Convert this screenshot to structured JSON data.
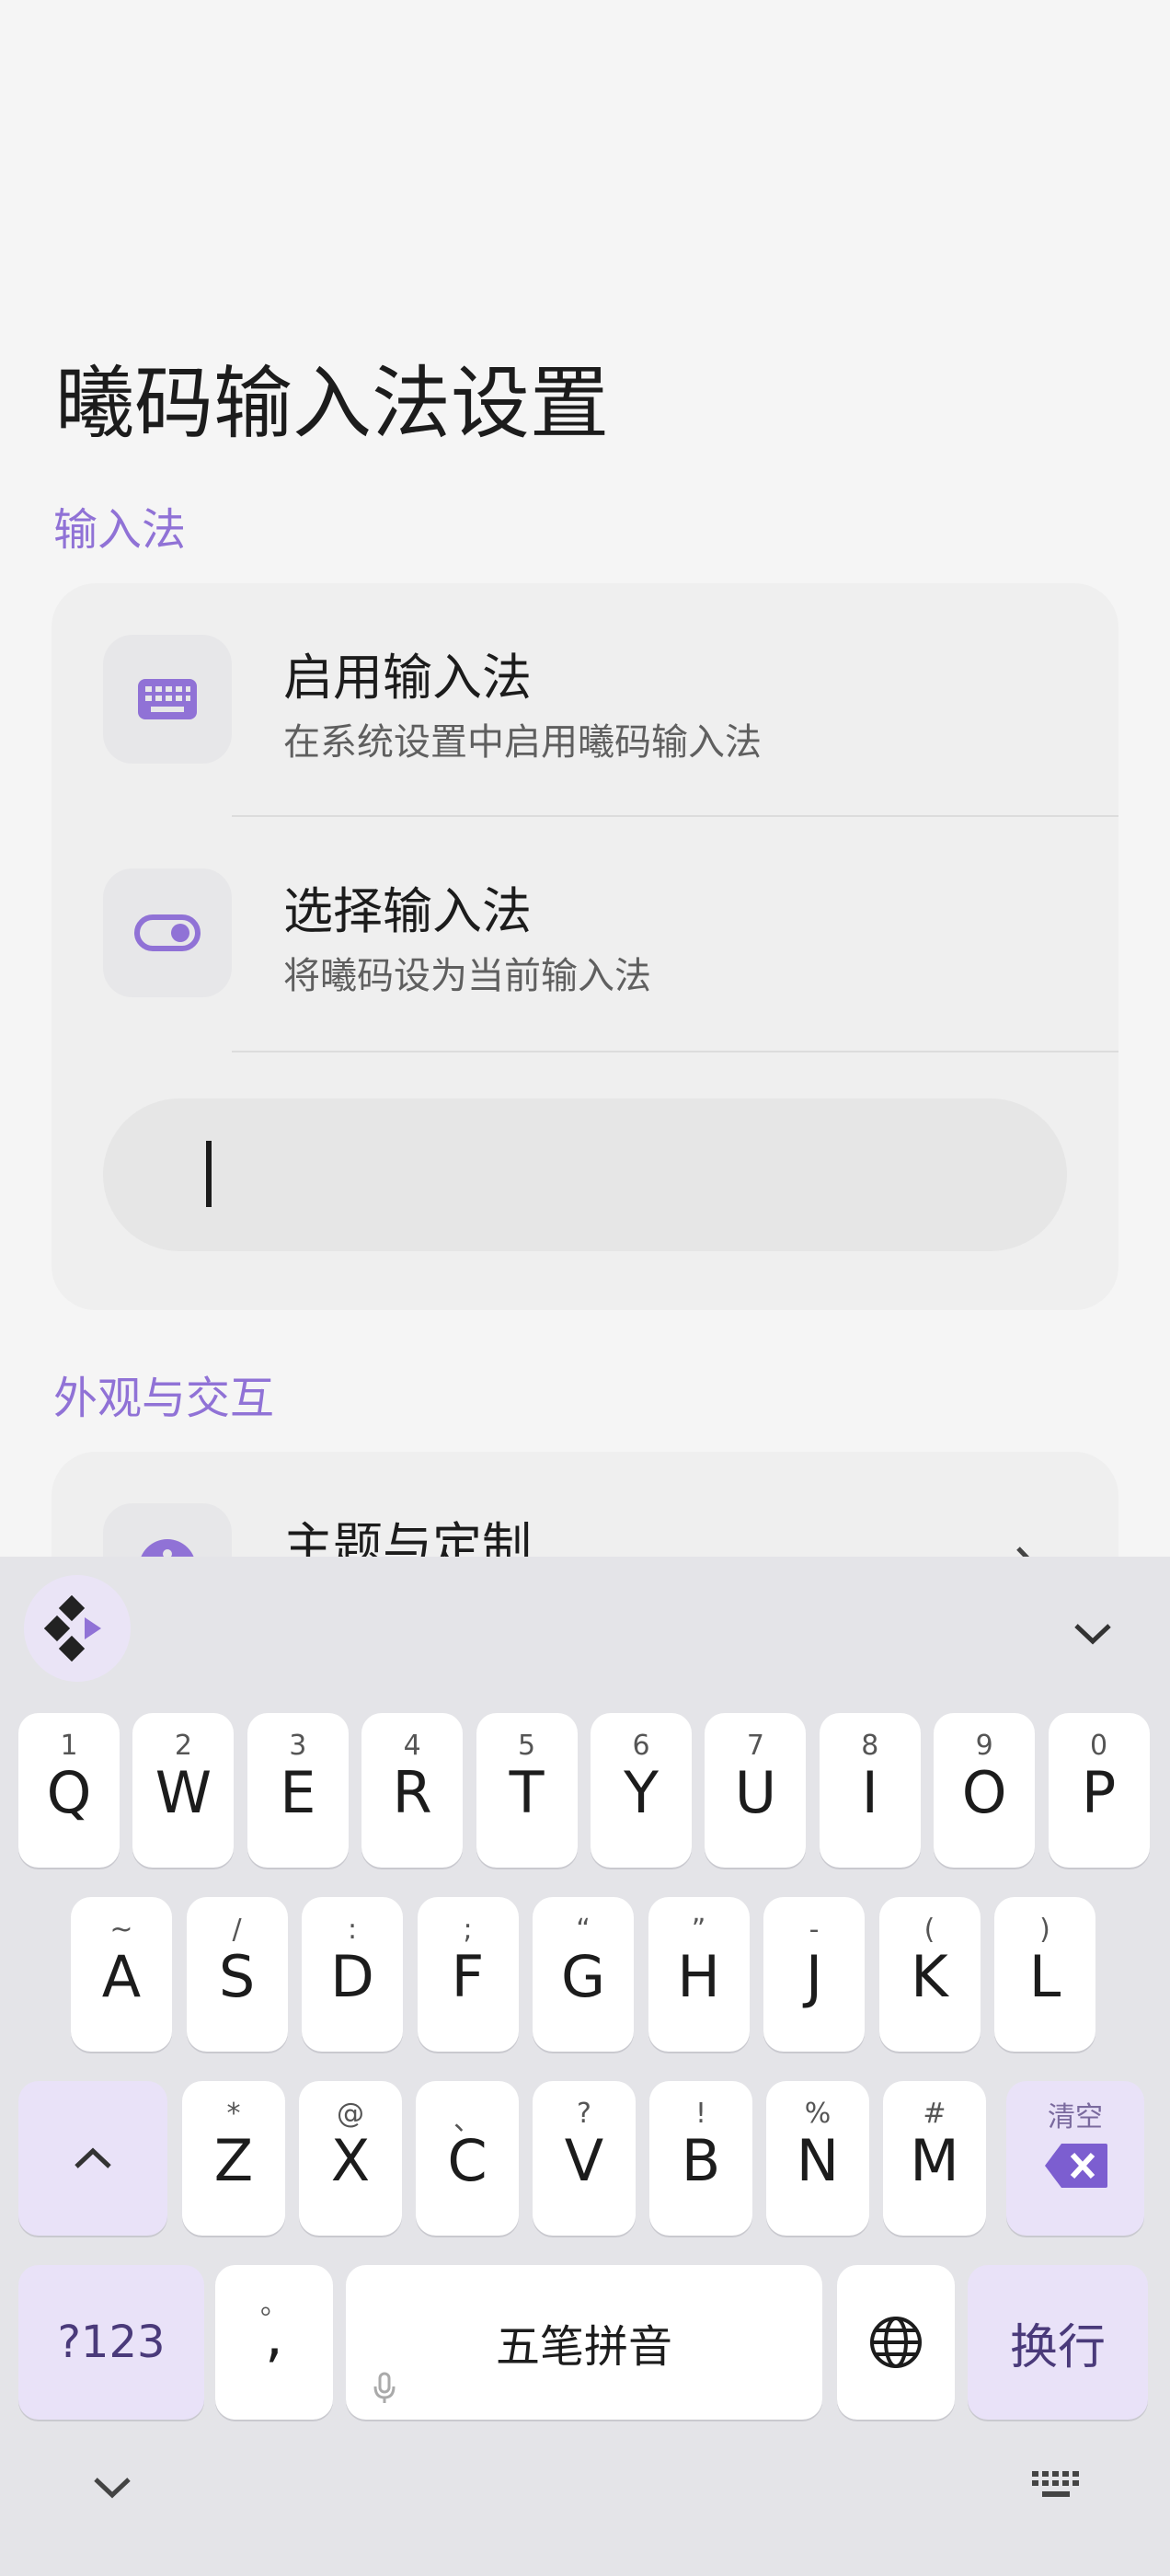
{
  "page": {
    "title": "曦码输入法设置"
  },
  "sections": [
    {
      "label": "输入法",
      "items": [
        {
          "title": "启用输入法",
          "subtitle": "在系统设置中启用曦码输入法",
          "icon": "keyboard-icon"
        },
        {
          "title": "选择输入法",
          "subtitle": "将曦码设为当前输入法",
          "icon": "toggle-icon"
        }
      ],
      "test_input": {
        "value": ""
      }
    },
    {
      "label": "外观与交互",
      "items": [
        {
          "title": "主题与定制",
          "icon": "palette-icon"
        }
      ]
    }
  ],
  "keyboard": {
    "rows": [
      [
        {
          "k": "Q",
          "h": "1"
        },
        {
          "k": "W",
          "h": "2"
        },
        {
          "k": "E",
          "h": "3"
        },
        {
          "k": "R",
          "h": "4"
        },
        {
          "k": "T",
          "h": "5"
        },
        {
          "k": "Y",
          "h": "6"
        },
        {
          "k": "U",
          "h": "7"
        },
        {
          "k": "I",
          "h": "8"
        },
        {
          "k": "O",
          "h": "9"
        },
        {
          "k": "P",
          "h": "0"
        }
      ],
      [
        {
          "k": "A",
          "h": "~"
        },
        {
          "k": "S",
          "h": "/"
        },
        {
          "k": "D",
          "h": ":"
        },
        {
          "k": "F",
          "h": ";"
        },
        {
          "k": "G",
          "h": "“"
        },
        {
          "k": "H",
          "h": "”"
        },
        {
          "k": "J",
          "h": "-"
        },
        {
          "k": "K",
          "h": "("
        },
        {
          "k": "L",
          "h": ")"
        }
      ],
      [
        {
          "k": "Z",
          "h": "*"
        },
        {
          "k": "X",
          "h": "@"
        },
        {
          "k": "C",
          "h": "、"
        },
        {
          "k": "V",
          "h": "?"
        },
        {
          "k": "B",
          "h": "!"
        },
        {
          "k": "N",
          "h": "%"
        },
        {
          "k": "M",
          "h": "#"
        }
      ]
    ],
    "delete_hint": "清空",
    "symbols_label": "?123",
    "comma_key": ",",
    "comma_hint": "。",
    "space_label": "五笔拼音",
    "enter_label": "换行",
    "accent_color": "#9072d6",
    "func_key_color": "#e9e2f8"
  }
}
